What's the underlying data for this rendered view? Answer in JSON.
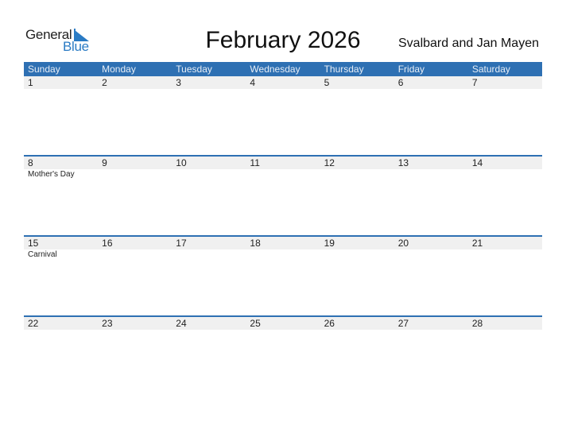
{
  "logo": {
    "line1": "General",
    "line2": "Blue"
  },
  "header": {
    "title": "February 2026",
    "region": "Svalbard and Jan Mayen"
  },
  "colors": {
    "accent": "#2e70b3",
    "day_strip": "#f0f0f0"
  },
  "days_of_week": [
    "Sunday",
    "Monday",
    "Tuesday",
    "Wednesday",
    "Thursday",
    "Friday",
    "Saturday"
  ],
  "weeks": [
    {
      "days": [
        "1",
        "2",
        "3",
        "4",
        "5",
        "6",
        "7"
      ],
      "events": [
        "",
        "",
        "",
        "",
        "",
        "",
        ""
      ]
    },
    {
      "days": [
        "8",
        "9",
        "10",
        "11",
        "12",
        "13",
        "14"
      ],
      "events": [
        "Mother's Day",
        "",
        "",
        "",
        "",
        "",
        ""
      ]
    },
    {
      "days": [
        "15",
        "16",
        "17",
        "18",
        "19",
        "20",
        "21"
      ],
      "events": [
        "Carnival",
        "",
        "",
        "",
        "",
        "",
        ""
      ]
    },
    {
      "days": [
        "22",
        "23",
        "24",
        "25",
        "26",
        "27",
        "28"
      ],
      "events": [
        "",
        "",
        "",
        "",
        "",
        "",
        ""
      ]
    }
  ]
}
